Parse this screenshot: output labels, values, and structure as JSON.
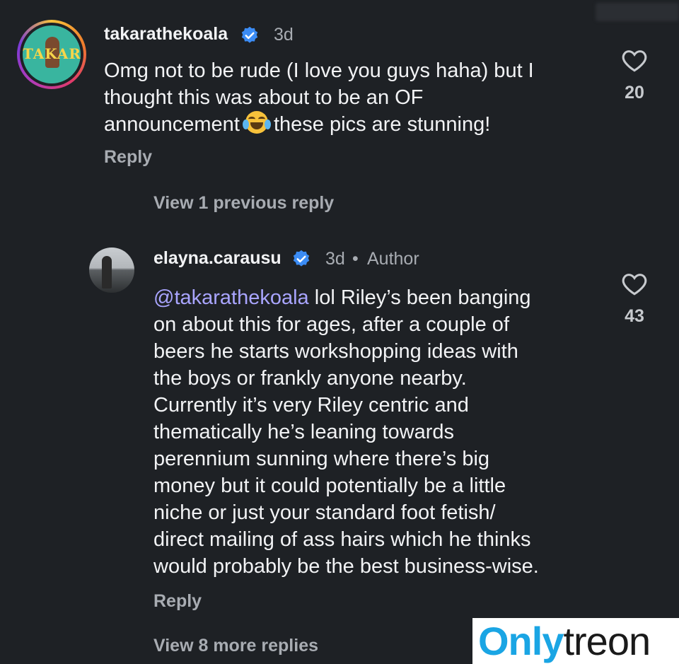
{
  "comments": [
    {
      "avatar_text": "TAKARA",
      "username": "takarathekoala",
      "time": "3d",
      "text": "Omg not to be rude (I love you guys haha) but I\nthought this was about to be an OF\nannouncement",
      "text_after_emoji": " these pics are stunning!",
      "emoji": "face-with-tears-of-joy-icon",
      "reply_label": "Reply",
      "likes": "20"
    },
    {
      "username": "elayna.carausu",
      "time": "3d",
      "author_badge": "Author",
      "mention": "@takarathekoala",
      "text": " lol Riley’s been banging\non about this for ages, after a couple of\nbeers he starts workshopping ideas with\nthe boys or frankly anyone nearby.\nCurrently it’s very Riley centric and\nthematically he’s leaning towards\nperennium sunning where there’s big\nmoney but it could potentially be a little\nniche or just your standard foot fetish/\ndirect mailing of ass hairs which he thinks\nwould probably be the best business-wise.",
      "reply_label": "Reply",
      "likes": "43"
    }
  ],
  "view_previous_label": "View 1 previous reply",
  "view_more_label": "View 8 more replies",
  "watermark": {
    "part1": "Only",
    "part2": "treon"
  },
  "colors": {
    "background": "#1e2125",
    "mention": "#a9a5ff",
    "verified": "#3b8cf5",
    "watermark_blue": "#1aa5e4"
  }
}
